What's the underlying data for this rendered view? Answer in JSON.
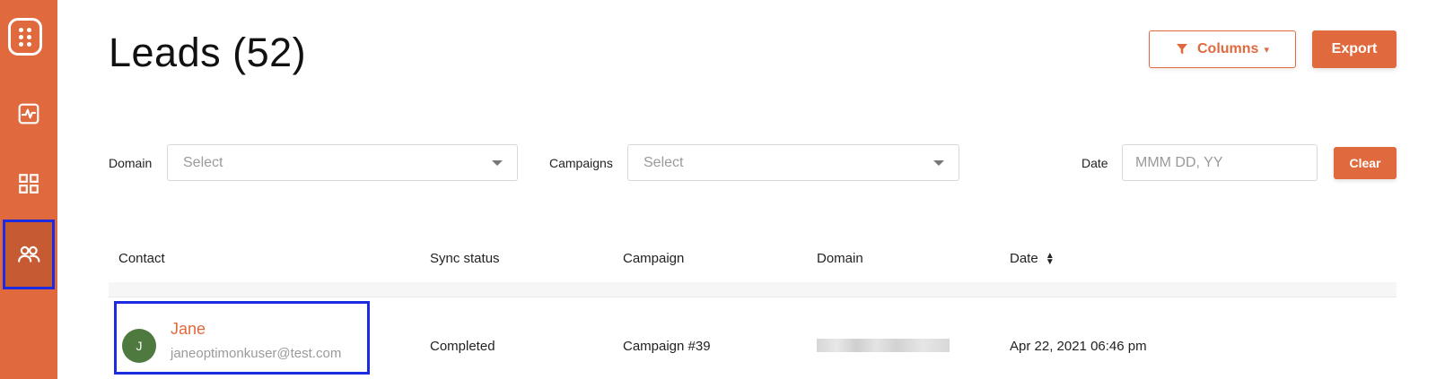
{
  "page": {
    "title": "Leads (52)"
  },
  "sidebar": {
    "items": [
      {
        "name": "analytics",
        "icon": "activity-icon"
      },
      {
        "name": "dashboard",
        "icon": "grid-icon"
      },
      {
        "name": "leads",
        "icon": "users-icon",
        "active": true
      }
    ]
  },
  "toolbar": {
    "columns_label": "Columns",
    "export_label": "Export"
  },
  "filters": {
    "domain_label": "Domain",
    "domain_placeholder": "Select",
    "campaigns_label": "Campaigns",
    "campaigns_placeholder": "Select",
    "date_label": "Date",
    "date_placeholder": "MMM DD, YY",
    "clear_label": "Clear"
  },
  "table": {
    "headers": {
      "contact": "Contact",
      "sync_status": "Sync status",
      "campaign": "Campaign",
      "domain": "Domain",
      "date": "Date"
    },
    "rows": [
      {
        "avatar_initial": "J",
        "name": "Jane",
        "email": "janeoptimonkuser@test.com",
        "sync_status": "Completed",
        "campaign": "Campaign #39",
        "domain_redacted": true,
        "date": "Apr 22, 2021 06:46 pm"
      }
    ]
  },
  "colors": {
    "accent": "#e0693d",
    "sidebar_active": "#c65a32",
    "avatar": "#4f7a3f",
    "highlight_outline": "#1a2be0"
  }
}
